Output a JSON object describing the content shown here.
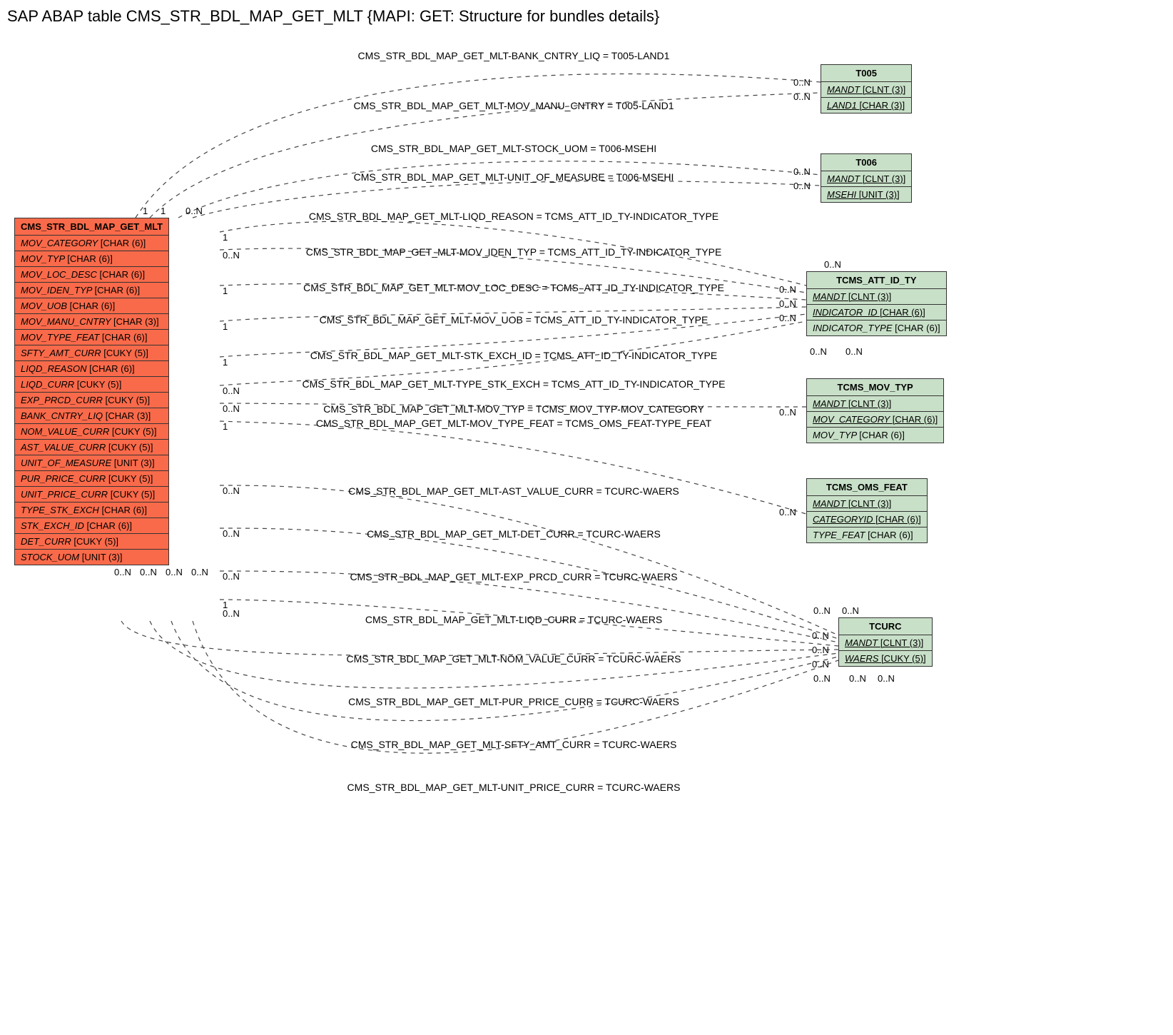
{
  "title": "SAP ABAP table CMS_STR_BDL_MAP_GET_MLT {MAPI: GET: Structure for bundles details}",
  "main_table": {
    "name": "CMS_STR_BDL_MAP_GET_MLT",
    "fields": [
      {
        "name": "MOV_CATEGORY",
        "type": "[CHAR (6)]"
      },
      {
        "name": "MOV_TYP",
        "type": "[CHAR (6)]"
      },
      {
        "name": "MOV_LOC_DESC",
        "type": "[CHAR (6)]"
      },
      {
        "name": "MOV_IDEN_TYP",
        "type": "[CHAR (6)]"
      },
      {
        "name": "MOV_UOB",
        "type": "[CHAR (6)]"
      },
      {
        "name": "MOV_MANU_CNTRY",
        "type": "[CHAR (3)]"
      },
      {
        "name": "MOV_TYPE_FEAT",
        "type": "[CHAR (6)]"
      },
      {
        "name": "SFTY_AMT_CURR",
        "type": "[CUKY (5)]"
      },
      {
        "name": "LIQD_REASON",
        "type": "[CHAR (6)]"
      },
      {
        "name": "LIQD_CURR",
        "type": "[CUKY (5)]"
      },
      {
        "name": "EXP_PRCD_CURR",
        "type": "[CUKY (5)]"
      },
      {
        "name": "BANK_CNTRY_LIQ",
        "type": "[CHAR (3)]"
      },
      {
        "name": "NOM_VALUE_CURR",
        "type": "[CUKY (5)]"
      },
      {
        "name": "AST_VALUE_CURR",
        "type": "[CUKY (5)]"
      },
      {
        "name": "UNIT_OF_MEASURE",
        "type": "[UNIT (3)]"
      },
      {
        "name": "PUR_PRICE_CURR",
        "type": "[CUKY (5)]"
      },
      {
        "name": "UNIT_PRICE_CURR",
        "type": "[CUKY (5)]"
      },
      {
        "name": "TYPE_STK_EXCH",
        "type": "[CHAR (6)]"
      },
      {
        "name": "STK_EXCH_ID",
        "type": "[CHAR (6)]"
      },
      {
        "name": "DET_CURR",
        "type": "[CUKY (5)]"
      },
      {
        "name": "STOCK_UOM",
        "type": "[UNIT (3)]"
      }
    ]
  },
  "ref_tables": [
    {
      "id": "t005",
      "name": "T005",
      "fields": [
        {
          "name": "MANDT",
          "type": "[CLNT (3)]",
          "u": true
        },
        {
          "name": "LAND1",
          "type": "[CHAR (3)]",
          "u": true
        }
      ]
    },
    {
      "id": "t006",
      "name": "T006",
      "fields": [
        {
          "name": "MANDT",
          "type": "[CLNT (3)]",
          "u": true
        },
        {
          "name": "MSEHI",
          "type": "[UNIT (3)]",
          "u": true
        }
      ]
    },
    {
      "id": "tcms_att",
      "name": "TCMS_ATT_ID_TY",
      "fields": [
        {
          "name": "MANDT",
          "type": "[CLNT (3)]",
          "u": true
        },
        {
          "name": "INDICATOR_ID",
          "type": "[CHAR (6)]",
          "u": true
        },
        {
          "name": "INDICATOR_TYPE",
          "type": "[CHAR (6)]"
        }
      ]
    },
    {
      "id": "tcms_mov",
      "name": "TCMS_MOV_TYP",
      "fields": [
        {
          "name": "MANDT",
          "type": "[CLNT (3)]",
          "u": true
        },
        {
          "name": "MOV_CATEGORY",
          "type": "[CHAR (6)]",
          "u": true
        },
        {
          "name": "MOV_TYP",
          "type": "[CHAR (6)]"
        }
      ]
    },
    {
      "id": "tcms_oms",
      "name": "TCMS_OMS_FEAT",
      "fields": [
        {
          "name": "MANDT",
          "type": "[CLNT (3)]",
          "u": true
        },
        {
          "name": "CATEGORYID",
          "type": "[CHAR (6)]",
          "u": true
        },
        {
          "name": "TYPE_FEAT",
          "type": "[CHAR (6)]"
        }
      ]
    },
    {
      "id": "tcurc",
      "name": "TCURC",
      "fields": [
        {
          "name": "MANDT",
          "type": "[CLNT (3)]",
          "u": true
        },
        {
          "name": "WAERS",
          "type": "[CUKY (5)]",
          "u": true
        }
      ]
    }
  ],
  "relations": [
    {
      "text": "CMS_STR_BDL_MAP_GET_MLT-BANK_CNTRY_LIQ = T005-LAND1"
    },
    {
      "text": "CMS_STR_BDL_MAP_GET_MLT-MOV_MANU_CNTRY = T005-LAND1"
    },
    {
      "text": "CMS_STR_BDL_MAP_GET_MLT-STOCK_UOM = T006-MSEHI"
    },
    {
      "text": "CMS_STR_BDL_MAP_GET_MLT-UNIT_OF_MEASURE = T006-MSEHI"
    },
    {
      "text": "CMS_STR_BDL_MAP_GET_MLT-LIQD_REASON = TCMS_ATT_ID_TY-INDICATOR_TYPE"
    },
    {
      "text": "CMS_STR_BDL_MAP_GET_MLT-MOV_IDEN_TYP = TCMS_ATT_ID_TY-INDICATOR_TYPE"
    },
    {
      "text": "CMS_STR_BDL_MAP_GET_MLT-MOV_LOC_DESC = TCMS_ATT_ID_TY-INDICATOR_TYPE"
    },
    {
      "text": "CMS_STR_BDL_MAP_GET_MLT-MOV_UOB = TCMS_ATT_ID_TY-INDICATOR_TYPE"
    },
    {
      "text": "CMS_STR_BDL_MAP_GET_MLT-STK_EXCH_ID = TCMS_ATT_ID_TY-INDICATOR_TYPE"
    },
    {
      "text": "CMS_STR_BDL_MAP_GET_MLT-TYPE_STK_EXCH = TCMS_ATT_ID_TY-INDICATOR_TYPE"
    },
    {
      "text": "CMS_STR_BDL_MAP_GET_MLT-MOV_TYP = TCMS_MOV_TYP-MOV_CATEGORY"
    },
    {
      "text": "CMS_STR_BDL_MAP_GET_MLT-MOV_TYPE_FEAT = TCMS_OMS_FEAT-TYPE_FEAT"
    },
    {
      "text": "CMS_STR_BDL_MAP_GET_MLT-AST_VALUE_CURR = TCURC-WAERS"
    },
    {
      "text": "CMS_STR_BDL_MAP_GET_MLT-DET_CURR = TCURC-WAERS"
    },
    {
      "text": "CMS_STR_BDL_MAP_GET_MLT-EXP_PRCD_CURR = TCURC-WAERS"
    },
    {
      "text": "CMS_STR_BDL_MAP_GET_MLT-LIQD_CURR = TCURC-WAERS"
    },
    {
      "text": "CMS_STR_BDL_MAP_GET_MLT-NOM_VALUE_CURR = TCURC-WAERS"
    },
    {
      "text": "CMS_STR_BDL_MAP_GET_MLT-PUR_PRICE_CURR = TCURC-WAERS"
    },
    {
      "text": "CMS_STR_BDL_MAP_GET_MLT-SFTY_AMT_CURR = TCURC-WAERS"
    },
    {
      "text": "CMS_STR_BDL_MAP_GET_MLT-UNIT_PRICE_CURR = TCURC-WAERS"
    }
  ],
  "cardinalities": {
    "left_top": [
      "1",
      "1",
      "0..N"
    ],
    "left_rows": [
      "1",
      "0..N",
      "1",
      "1",
      "1",
      "0..N",
      "0..N",
      "1",
      "0..N",
      "0..N",
      "0..N",
      "1",
      "0..N"
    ],
    "left_bottom": [
      "0..N",
      "0..N",
      "0..N",
      "0..N"
    ],
    "t005": [
      "0..N",
      "0..N"
    ],
    "t006": [
      "0..N",
      "0..N"
    ],
    "tcms_att": [
      "0..N",
      "0..N",
      "0..N",
      "0..N",
      "0..N",
      "0..N"
    ],
    "tcms_mov": [
      "0..N"
    ],
    "tcms_oms": [
      "0..N"
    ],
    "tcurc": [
      "0..N",
      "0..N",
      "0..N",
      "0..N",
      "0..N",
      "0..N",
      "0..N",
      "0..N"
    ]
  }
}
